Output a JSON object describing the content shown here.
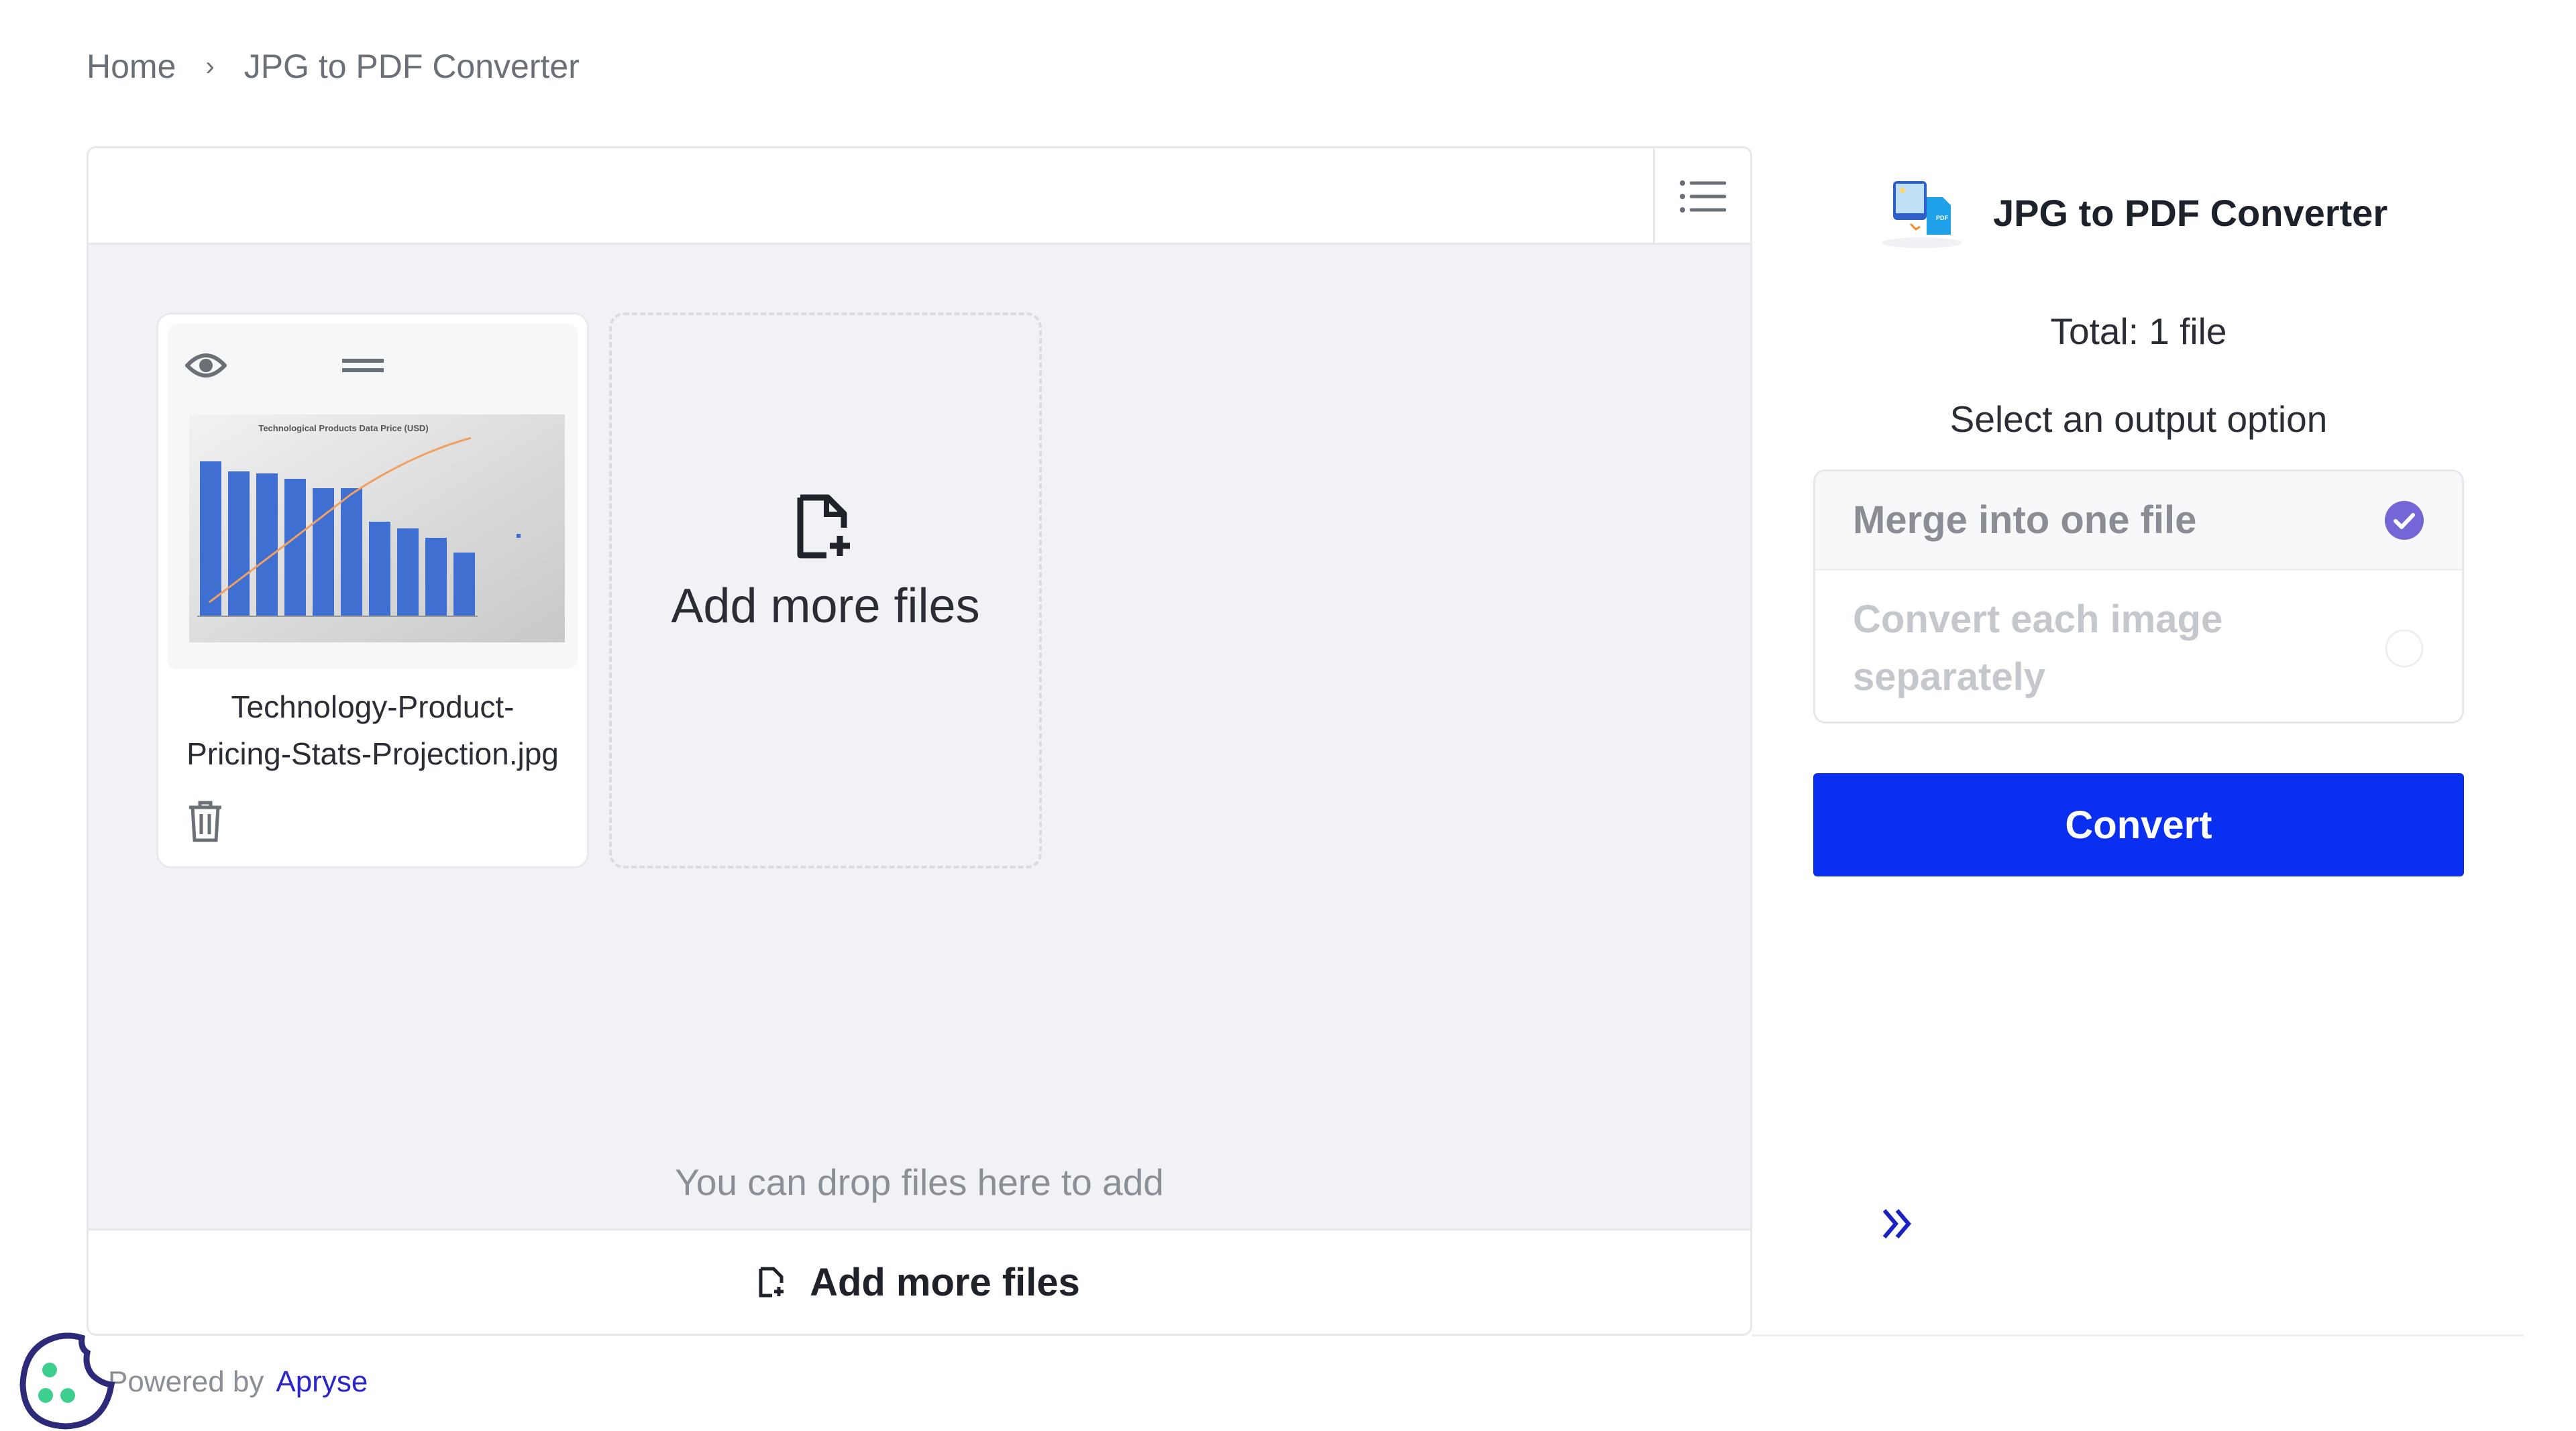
{
  "breadcrumb": {
    "home": "Home",
    "separator": "›",
    "current": "JPG to PDF Converter"
  },
  "toolbar": {
    "list_view_icon": "list-icon"
  },
  "files": [
    {
      "name_line1": "Technology-Product-",
      "name_line2": "Pricing-Stats-Projection.jpg",
      "thumbnail_title": "Technological Products Data Price (USD)"
    }
  ],
  "add_card": {
    "label": "Add more files",
    "icon": "file-plus-icon"
  },
  "drop_hint": "You can drop files here to add",
  "bottom_bar": {
    "add_label": "Add more files"
  },
  "sidebar": {
    "title": "JPG to PDF Converter",
    "total": "Total: 1 file",
    "output_prompt": "Select an output option",
    "options": [
      {
        "label": "Merge into one file",
        "selected": true
      },
      {
        "label_line1": "Convert each image",
        "label_line2": "separately",
        "selected": false
      }
    ],
    "convert_label": "Convert",
    "collapse_icon": "double-chevron-right-icon"
  },
  "footer": {
    "powered_by": "Powered by",
    "brand": "Apryse"
  },
  "colors": {
    "accent": "#0a2ff0",
    "check": "#7466d6",
    "link": "#2a25c8",
    "cookie_outline": "#2e2a7a",
    "cookie_dots": "#3ecf8e"
  }
}
